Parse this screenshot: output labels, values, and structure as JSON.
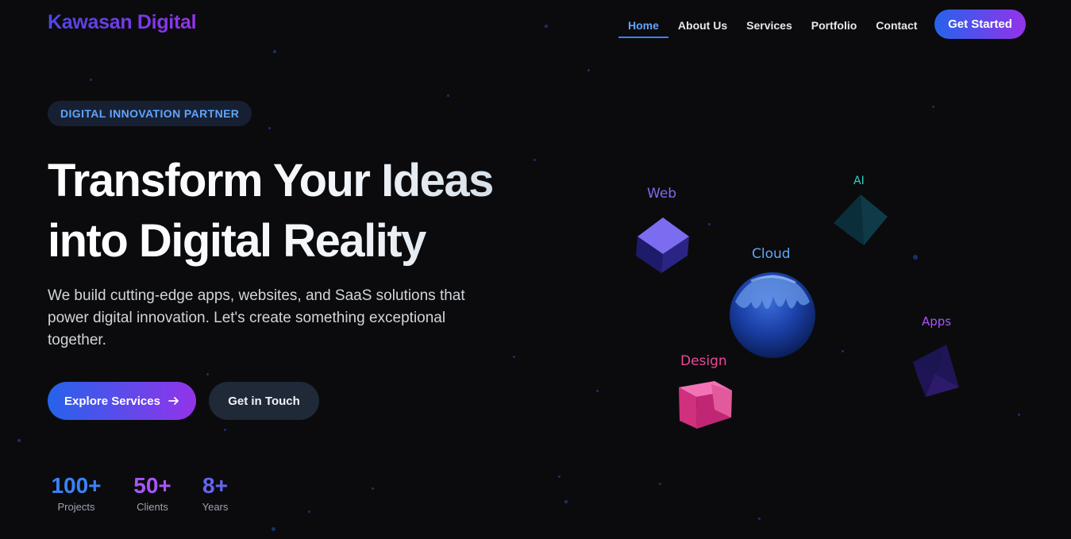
{
  "brand": {
    "name": "Kawasan Digital"
  },
  "nav": {
    "items": [
      {
        "label": "Home",
        "active": true
      },
      {
        "label": "About Us",
        "active": false
      },
      {
        "label": "Services",
        "active": false
      },
      {
        "label": "Portfolio",
        "active": false
      },
      {
        "label": "Contact",
        "active": false
      }
    ],
    "cta_label": "Get Started"
  },
  "hero": {
    "badge": "DIGITAL INNOVATION PARTNER",
    "headline_line1": "Transform Your Ideas",
    "headline_line2": "into Digital Reality",
    "subtitle": "We build cutting-edge apps, websites, and SaaS solutions that power digital innovation. Let's create something exceptional together.",
    "primary_button": "Explore Services",
    "primary_button_icon": "arrow-right-icon",
    "secondary_button": "Get in Touch"
  },
  "stats": [
    {
      "value": "100+",
      "label": "Projects",
      "color": "#3b82f6"
    },
    {
      "value": "50+",
      "label": "Clients",
      "color": "#a855f7"
    },
    {
      "value": "8+",
      "label": "Years",
      "color": "#6366f1"
    }
  ],
  "scene": {
    "labels": {
      "web": "Web",
      "ai": "AI",
      "cloud": "Cloud",
      "apps": "Apps",
      "design": "Design"
    },
    "colors": {
      "web": "#7c6cf0",
      "ai": "#2dd4bf",
      "cloud": "#60a5fa",
      "apps": "#a855f7",
      "design": "#ec4899"
    }
  },
  "colors": {
    "background": "#0b0b0d",
    "accent_blue": "#2563eb",
    "accent_purple": "#9333ea"
  }
}
